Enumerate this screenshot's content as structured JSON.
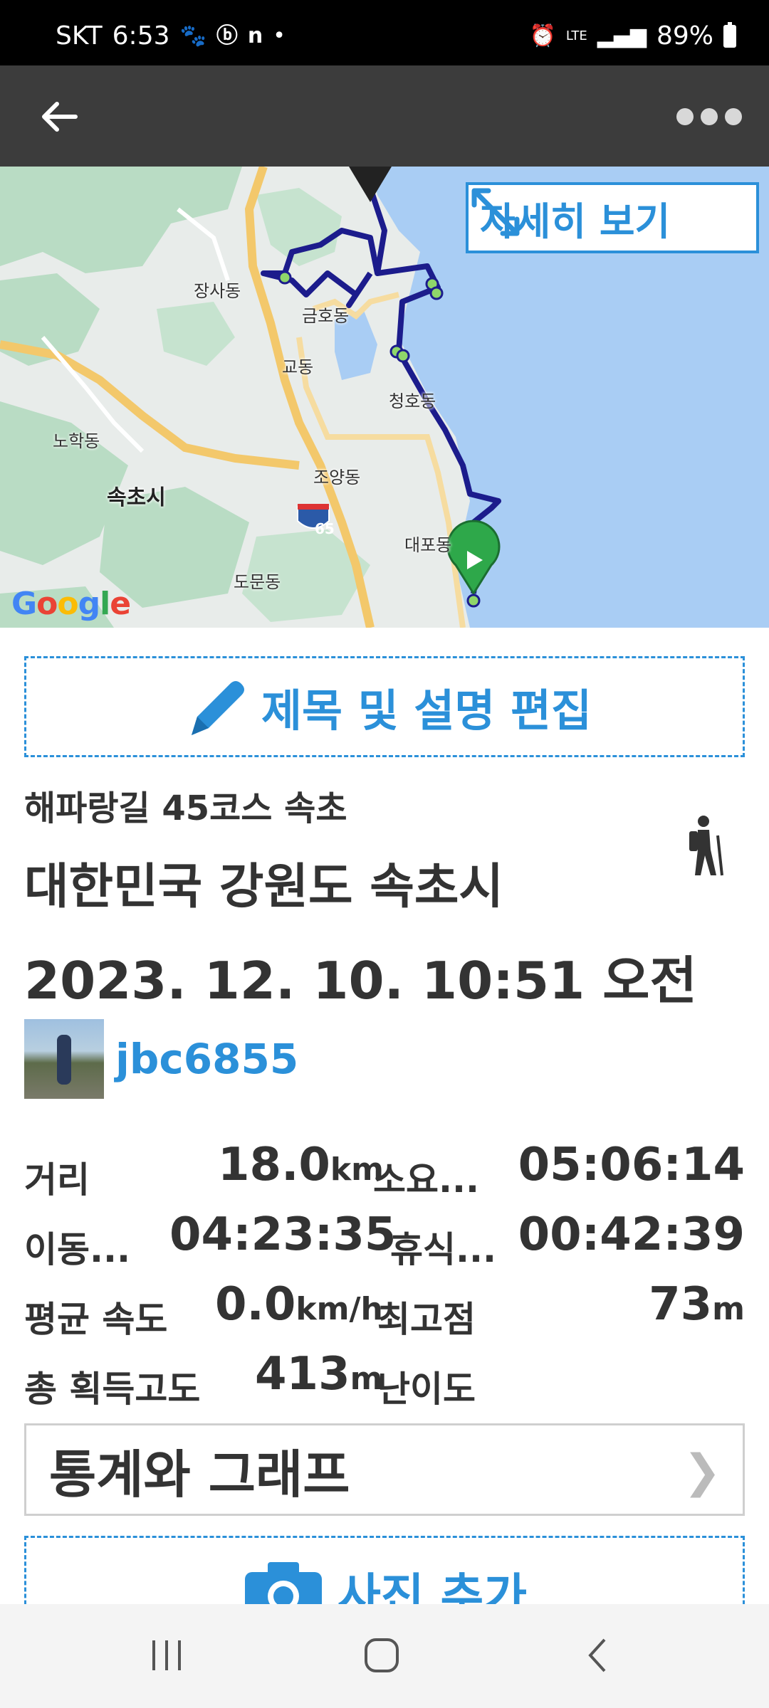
{
  "status_bar": {
    "carrier": "SKT",
    "time": "6:53",
    "network": "LTE",
    "battery": "89%",
    "icons": [
      "paw-icon",
      "b-app-icon",
      "n-app-icon",
      "dot-icon",
      "alarm-icon",
      "signal-icon",
      "battery-icon"
    ]
  },
  "app_bar": {
    "back_icon": "arrow-left-icon",
    "more_icon": "more-dots-icon"
  },
  "map": {
    "detail_button": "자세히 보기",
    "labels": {
      "jangsa": "장사동",
      "geumho": "금호동",
      "gyo": "교동",
      "cheongho": "청호동",
      "nohak": "노학동",
      "sokcho": "속초시",
      "joyang": "조양동",
      "daepo": "대포동",
      "domun": "도문동",
      "route_shield": "65"
    },
    "google_logo": "Google",
    "route_color": "#1c1c8c"
  },
  "edit_button": "제목 및 설명 편집",
  "trip": {
    "title": "해파랑길 45코스 속초",
    "location": "대한민국 강원도 속초시",
    "datetime": "2023. 12. 10. 10:51 오전",
    "activity_icon": "hiking-icon"
  },
  "user": {
    "name": "jbc6855"
  },
  "stats": {
    "distance_label": "거리",
    "distance_value": "18.0",
    "distance_unit": "km",
    "duration_label": "소요...",
    "duration_value": "05:06:14",
    "moving_label": "이동...",
    "moving_value": "04:23:35",
    "rest_label": "휴식...",
    "rest_value": "00:42:39",
    "avg_speed_label": "평균 속도",
    "avg_speed_value": "0.0",
    "avg_speed_unit": "km/h",
    "max_elev_label": "최고점",
    "max_elev_value": "73",
    "max_elev_unit": "m",
    "gain_label": "총 획득고도",
    "gain_value": "413",
    "gain_unit": "m",
    "difficulty_label": "난이도"
  },
  "stats_graph_button": "통계와 그래프",
  "add_photo_button": "사진 추가",
  "colors": {
    "accent": "#2b90d9",
    "app_bar": "#3c3c3c",
    "text": "#333333"
  }
}
